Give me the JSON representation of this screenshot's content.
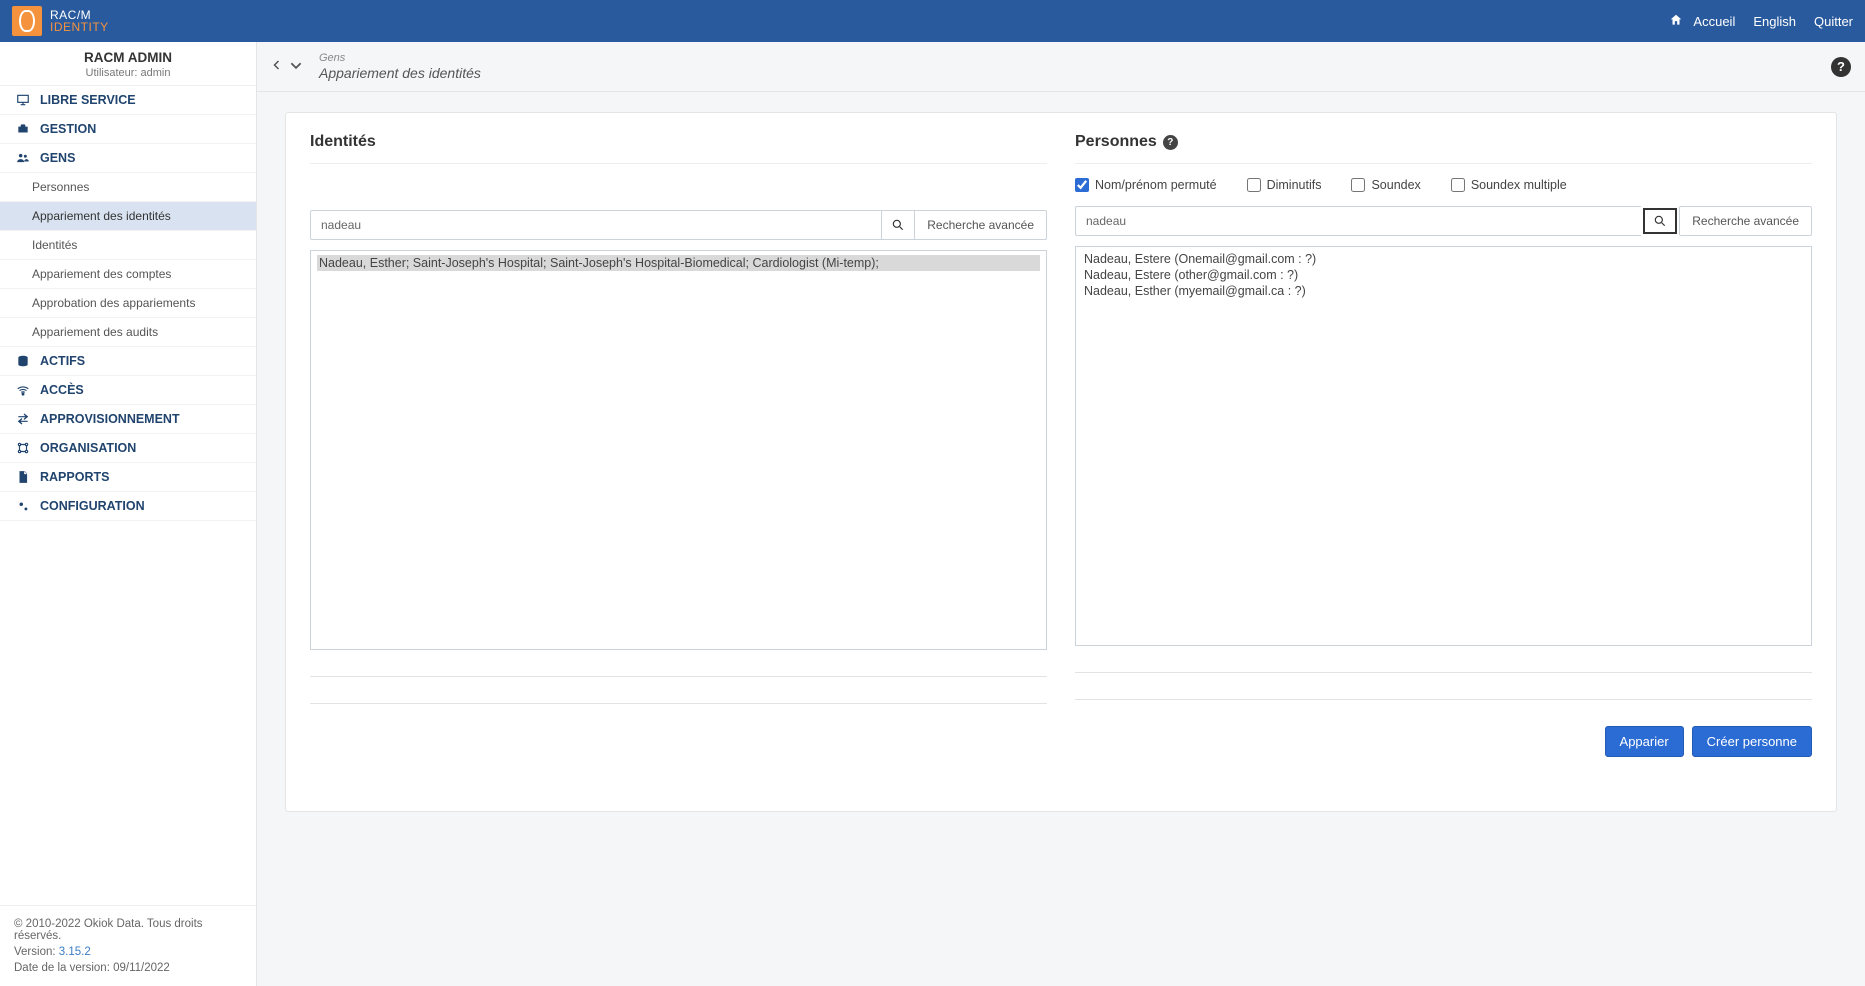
{
  "top": {
    "brand_line1": "RAC/M",
    "brand_line2": "IDENTITY",
    "home": "Accueil",
    "lang": "English",
    "quit": "Quitter"
  },
  "user": {
    "name": "RACM ADMIN",
    "sub": "Utilisateur: admin"
  },
  "nav": {
    "self_service": "LIBRE SERVICE",
    "management": "GESTION",
    "people": "GENS",
    "people_sub": {
      "persons": "Personnes",
      "identity_matching": "Appariement des identités",
      "identities": "Identités",
      "account_matching": "Appariement des comptes",
      "matching_approval": "Approbation des appariements",
      "audit_matching": "Appariement des audits"
    },
    "assets": "ACTIFS",
    "access": "ACCÈS",
    "provisioning": "APPROVISIONNEMENT",
    "organization": "ORGANISATION",
    "reports": "RAPPORTS",
    "configuration": "CONFIGURATION"
  },
  "footer": {
    "copyright": "© 2010-2022 Okiok Data. Tous droits réservés.",
    "version_label": "Version: ",
    "version": "3.15.2",
    "date_label": "Date de la version: ",
    "date": "09/11/2022"
  },
  "crumb": {
    "section": "Gens",
    "page": "Appariement des identités"
  },
  "identities": {
    "heading": "Identités",
    "search_value": "nadeau",
    "advanced": "Recherche avancée",
    "results": [
      "Nadeau, Esther; Saint-Joseph's Hospital; Saint-Joseph's Hospital-Biomedical; Cardiologist (Mi-temp);"
    ]
  },
  "persons": {
    "heading": "Personnes",
    "checks": {
      "permuted": "Nom/prénom permuté",
      "diminutives": "Diminutifs",
      "soundex": "Soundex",
      "soundex_multiple": "Soundex multiple"
    },
    "search_value": "nadeau",
    "advanced": "Recherche avancée",
    "results": [
      "Nadeau, Estere (Onemail@gmail.com : ?)",
      "Nadeau, Estere (other@gmail.com : ?)",
      "Nadeau, Esther (myemail@gmail.ca : ?)"
    ]
  },
  "buttons": {
    "match": "Apparier",
    "create": "Créer personne"
  }
}
